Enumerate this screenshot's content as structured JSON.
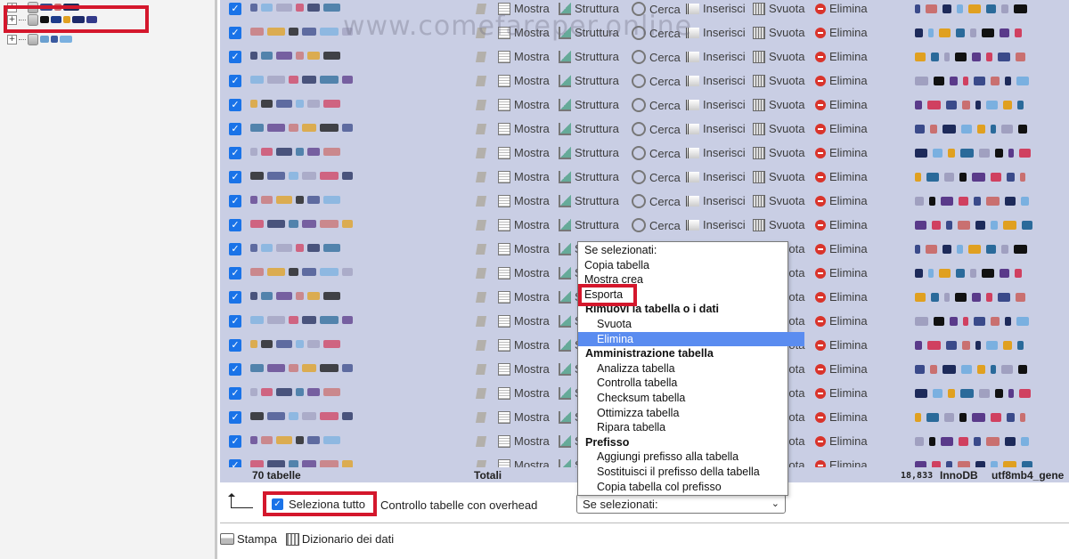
{
  "watermark": "www.comefareper.online",
  "nav": {
    "tree_nodes": [
      {
        "expander": "+",
        "highlighted": false
      },
      {
        "expander": "+",
        "highlighted": true
      },
      {
        "expander": "+",
        "highlighted": false
      }
    ]
  },
  "actions": {
    "mostra": "Mostra",
    "struttura": "Struttura",
    "cerca": "Cerca",
    "inserisci": "Inserisci",
    "svuota": "Svuota",
    "elimina": "Elimina"
  },
  "row_count": 20,
  "totals": {
    "tables": "70 tabelle",
    "label": "Totali",
    "size": "18,833",
    "engine": "InnoDB",
    "collation": "utf8mb4_gene"
  },
  "bottom": {
    "select_all": "Seleziona tutto",
    "overhead": "Controllo tabelle con overhead",
    "selected_value": "Se selezionati:"
  },
  "footer": {
    "print": "Stampa",
    "dictionary": "Dizionario dei dati"
  },
  "dropdown": {
    "options": [
      {
        "label": "Se selezionati:",
        "type": "lvl0"
      },
      {
        "label": "Copia tabella",
        "type": "lvl0"
      },
      {
        "label": "Mostra crea",
        "type": "lvl0"
      },
      {
        "label": "Esporta",
        "type": "lvl0"
      },
      {
        "label": "Rimuovi la tabella o i dati",
        "type": "group"
      },
      {
        "label": "Svuota",
        "type": "lvl1"
      },
      {
        "label": "Elimina",
        "type": "lvl1",
        "highlighted": true
      },
      {
        "label": "Amministrazione tabella",
        "type": "group"
      },
      {
        "label": "Analizza tabella",
        "type": "lvl1"
      },
      {
        "label": "Controlla tabella",
        "type": "lvl1"
      },
      {
        "label": "Checksum tabella",
        "type": "lvl1"
      },
      {
        "label": "Ottimizza tabella",
        "type": "lvl1"
      },
      {
        "label": "Ripara tabella",
        "type": "lvl1"
      },
      {
        "label": "Prefisso",
        "type": "group"
      },
      {
        "label": "Aggiungi prefisso alla tabella",
        "type": "lvl1"
      },
      {
        "label": "Sostituisci il prefisso della tabella",
        "type": "lvl1"
      },
      {
        "label": "Copia tabella col prefisso",
        "type": "lvl1"
      }
    ]
  },
  "colors": {
    "row_bg": "#c9cee4",
    "checkbox": "#1a73e8",
    "highlight_red": "#d4172c",
    "option_selected": "#5a8cf0"
  }
}
